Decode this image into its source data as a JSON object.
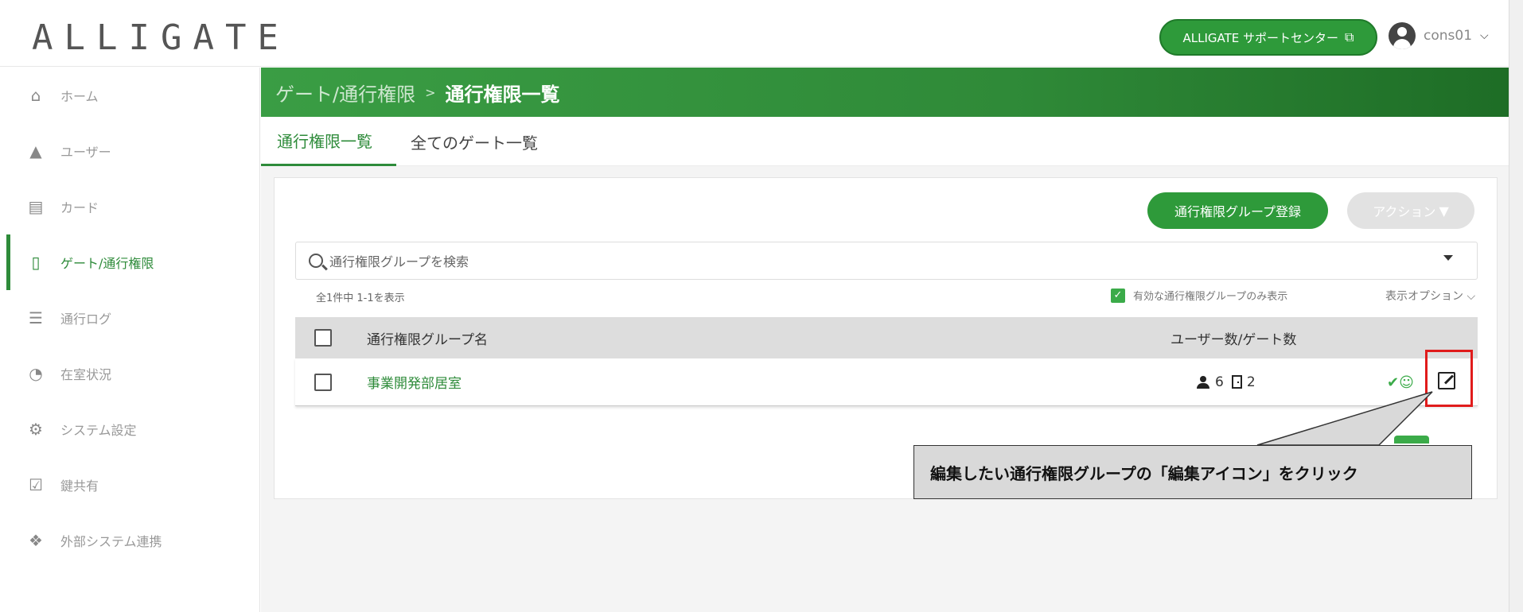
{
  "header": {
    "logo": "ALLIGATE",
    "support_button": "ALLIGATE サポートセンター",
    "user_name": "cons01"
  },
  "sidebar": {
    "items": [
      {
        "label": "ホーム",
        "icon": "home-icon"
      },
      {
        "label": "ユーザー",
        "icon": "user-icon"
      },
      {
        "label": "カード",
        "icon": "card-icon"
      },
      {
        "label": "ゲート/通行権限",
        "icon": "door-icon",
        "active": true
      },
      {
        "label": "通行ログ",
        "icon": "list-icon"
      },
      {
        "label": "在室状況",
        "icon": "presence-icon"
      },
      {
        "label": "システム設定",
        "icon": "gear-icon"
      },
      {
        "label": "鍵共有",
        "icon": "checkbox-icon"
      },
      {
        "label": "外部システム連携",
        "icon": "puzzle-icon"
      }
    ]
  },
  "breadcrumb": {
    "parent": "ゲート/通行権限",
    "current": "通行権限一覧"
  },
  "tabs": [
    {
      "label": "通行権限一覧",
      "active": true
    },
    {
      "label": "全てのゲート一覧",
      "active": false
    }
  ],
  "toolbar": {
    "register_button": "通行権限グループ登録",
    "action_button": "アクション"
  },
  "search": {
    "placeholder": "通行権限グループを検索"
  },
  "list": {
    "count_text": "全1件中 1-1を表示",
    "filter_label": "有効な通行権限グループのみ表示",
    "display_options": "表示オプション"
  },
  "table": {
    "headers": {
      "name": "通行権限グループ名",
      "counts": "ユーザー数/ゲート数"
    },
    "rows": [
      {
        "name": "事業開発部居室",
        "users": "6",
        "gates": "2"
      }
    ]
  },
  "callout": {
    "text": "編集したい通行権限グループの「編集アイコン」をクリック"
  },
  "colors": {
    "accent": "#2e9a3a",
    "highlight": "#e01b1b"
  }
}
